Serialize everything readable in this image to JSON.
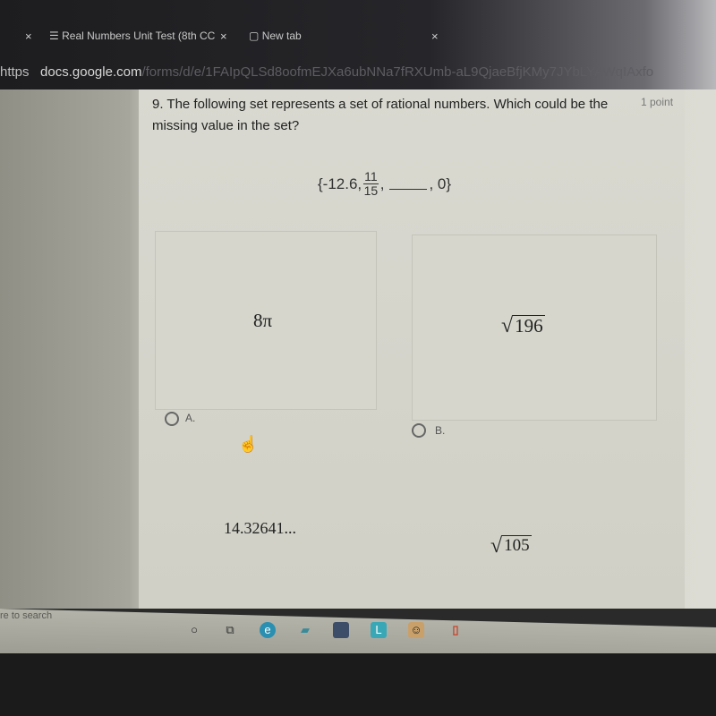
{
  "browser": {
    "tabs": [
      {
        "label": "Real Numbers Unit Test (8th CC",
        "icon": "forms-list-icon"
      },
      {
        "label": "New tab",
        "icon": "new-tab-icon"
      }
    ],
    "url": {
      "scheme": "https",
      "host": "docs.google.com",
      "path": "/forms/d/e/1FAIpQLSd8oofmEJXa6ubNNa7fRXUmb-aL9QjaeBfjKMy7JYbLYAWqIAxfo"
    }
  },
  "question": {
    "text": "9. The following set represents a set of rational numbers. Which could be the missing value in the set?",
    "points": "1 point",
    "set": {
      "open": "{-12.6,",
      "frac_num": "11",
      "frac_den": "15",
      "comma": ",",
      "close": ", 0}"
    },
    "options": [
      {
        "label": "A.",
        "value": "8π"
      },
      {
        "label": "B.",
        "value": "196",
        "sqrt": true
      },
      {
        "label": "",
        "value": "14.32641..."
      },
      {
        "label": "",
        "value": "105",
        "sqrt": true
      }
    ]
  },
  "taskbar": {
    "search_placeholder": "re to search",
    "icons": [
      "cortana-icon",
      "task-view-icon",
      "edge-icon",
      "file-explorer-icon",
      "store-icon",
      "lexia-icon",
      "app-icon",
      "office-icon"
    ]
  }
}
